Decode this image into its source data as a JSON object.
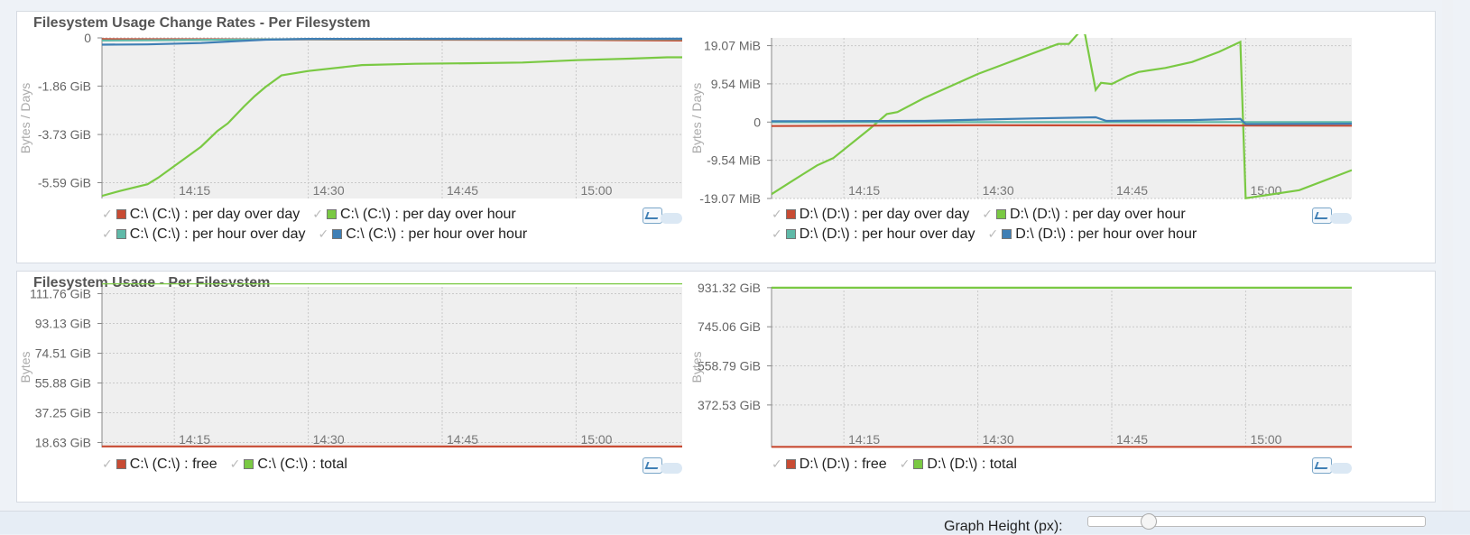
{
  "panels": {
    "rates_title": "Filesystem Usage Change Rates - Per Filesystem",
    "usage_title": "Filesystem Usage - Per Filesystem"
  },
  "footer": {
    "graph_height_label": "Graph Height (px):",
    "graph_height_level": 0.18
  },
  "colors": {
    "red": "#c84b33",
    "green": "#7ac943",
    "teal": "#5fb9a8",
    "blue": "#3f7fb5"
  },
  "chart_data": [
    {
      "id": "c_rates",
      "type": "line",
      "ylabel": "Bytes / Days",
      "ylim": [
        -6.2,
        0
      ],
      "yticks": [
        0,
        -1.86,
        -3.73,
        -5.59
      ],
      "yticklabels": [
        "0",
        "-1.86 GiB",
        "-3.73 GiB",
        "-5.59 GiB"
      ],
      "xlim": [
        14.115,
        15.198
      ],
      "xticks": [
        14.25,
        14.5,
        14.75,
        15.0
      ],
      "xticklabels": [
        "14:15",
        "14:30",
        "14:45",
        "15:00"
      ],
      "grid": true,
      "legend": [
        {
          "label": "C:\\ (C:\\) : per day over day",
          "color": "#c84b33"
        },
        {
          "label": "C:\\ (C:\\) : per day over hour",
          "color": "#7ac943"
        },
        {
          "label": "C:\\ (C:\\) : per hour over day",
          "color": "#5fb9a8"
        },
        {
          "label": "C:\\ (C:\\) : per hour over hour",
          "color": "#3f7fb5"
        }
      ],
      "series": [
        {
          "name": "C:\\ (C:\\) : per day over day",
          "color": "#c84b33",
          "x": [
            14.115,
            14.5,
            15.0,
            15.198
          ],
          "y": [
            -0.05,
            -0.06,
            -0.08,
            -0.1
          ]
        },
        {
          "name": "C:\\ (C:\\) : per day over hour",
          "color": "#7ac943",
          "x": [
            14.115,
            14.15,
            14.2,
            14.22,
            14.3,
            14.33,
            14.35,
            14.38,
            14.4,
            14.42,
            14.45,
            14.5,
            14.6,
            14.7,
            14.8,
            14.9,
            15.0,
            15.1,
            15.17,
            15.198
          ],
          "y": [
            -6.1,
            -5.9,
            -5.65,
            -5.4,
            -4.2,
            -3.6,
            -3.3,
            -2.65,
            -2.25,
            -1.9,
            -1.45,
            -1.28,
            -1.05,
            -1.0,
            -0.98,
            -0.95,
            -0.86,
            -0.8,
            -0.75,
            -0.75
          ]
        },
        {
          "name": "C:\\ (C:\\) : per hour over day",
          "color": "#5fb9a8",
          "x": [
            14.115,
            14.5,
            15.198
          ],
          "y": [
            -0.1,
            -0.05,
            -0.05
          ]
        },
        {
          "name": "C:\\ (C:\\) : per hour over hour",
          "color": "#3f7fb5",
          "x": [
            14.115,
            14.2,
            14.3,
            14.42,
            14.5,
            15.198
          ],
          "y": [
            -0.26,
            -0.25,
            -0.2,
            -0.07,
            -0.04,
            -0.03
          ]
        }
      ]
    },
    {
      "id": "d_rates",
      "type": "line",
      "ylabel": "Bytes / Days",
      "ylim": [
        -19.07,
        21
      ],
      "yticks": [
        19.07,
        9.54,
        0,
        -9.54,
        -19.07
      ],
      "yticklabels": [
        "19.07 MiB",
        "9.54 MiB",
        "0",
        "-9.54 MiB",
        "-19.07 MiB"
      ],
      "xlim": [
        14.115,
        15.198
      ],
      "xticks": [
        14.25,
        14.5,
        14.75,
        15.0
      ],
      "xticklabels": [
        "14:15",
        "14:30",
        "14:45",
        "15:00"
      ],
      "grid": true,
      "legend": [
        {
          "label": "D:\\ (D:\\) : per day over day",
          "color": "#c84b33"
        },
        {
          "label": "D:\\ (D:\\) : per day over hour",
          "color": "#7ac943"
        },
        {
          "label": "D:\\ (D:\\) : per hour over day",
          "color": "#5fb9a8"
        },
        {
          "label": "D:\\ (D:\\) : per hour over hour",
          "color": "#3f7fb5"
        }
      ],
      "series": [
        {
          "name": "D:\\ (D:\\) : per day over day",
          "color": "#c84b33",
          "x": [
            14.115,
            14.5,
            15.198
          ],
          "y": [
            -1.0,
            -0.8,
            -0.9
          ]
        },
        {
          "name": "D:\\ (D:\\) : per day over hour",
          "color": "#7ac943",
          "x": [
            14.115,
            14.15,
            14.2,
            14.23,
            14.3,
            14.33,
            14.35,
            14.4,
            14.5,
            14.55,
            14.58,
            14.62,
            14.65,
            14.67,
            14.69,
            14.7,
            14.72,
            14.73,
            14.75,
            14.78,
            14.8,
            14.85,
            14.9,
            14.95,
            14.99,
            15.0,
            15.1,
            15.198
          ],
          "y": [
            -18.0,
            -15.0,
            -10.8,
            -9.0,
            -1.5,
            2.0,
            2.5,
            6.0,
            12.0,
            14.5,
            16.0,
            18.0,
            19.5,
            19.5,
            22.5,
            22.0,
            8.0,
            9.8,
            9.5,
            11.5,
            12.5,
            13.5,
            15.0,
            17.5,
            20.0,
            -19.0,
            -17.0,
            -12.0
          ]
        },
        {
          "name": "D:\\ (D:\\) : per hour over day",
          "color": "#5fb9a8",
          "x": [
            14.115,
            14.5,
            15.198
          ],
          "y": [
            0.0,
            0.0,
            0.0
          ]
        },
        {
          "name": "D:\\ (D:\\) : per hour over hour",
          "color": "#3f7fb5",
          "x": [
            14.115,
            14.4,
            14.5,
            14.6,
            14.72,
            14.74,
            14.9,
            14.99,
            15.0,
            15.198
          ],
          "y": [
            0.2,
            0.3,
            0.6,
            0.9,
            1.2,
            0.3,
            0.5,
            0.8,
            -0.5,
            -0.4
          ]
        }
      ]
    },
    {
      "id": "c_usage",
      "type": "line",
      "ylabel": "Bytes",
      "ylim": [
        15.5,
        116
      ],
      "yticks": [
        111.76,
        93.13,
        74.51,
        55.88,
        37.25,
        18.63
      ],
      "yticklabels": [
        "111.76 GiB",
        "93.13 GiB",
        "74.51 GiB",
        "55.88 GiB",
        "37.25 GiB",
        "18.63 GiB"
      ],
      "xlim": [
        14.115,
        15.198
      ],
      "xticks": [
        14.25,
        14.5,
        14.75,
        15.0
      ],
      "xticklabels": [
        "14:15",
        "14:30",
        "14:45",
        "15:00"
      ],
      "grid": true,
      "legend": [
        {
          "label": "C:\\ (C:\\) : free",
          "color": "#c84b33"
        },
        {
          "label": "C:\\ (C:\\) : total",
          "color": "#7ac943"
        }
      ],
      "series": [
        {
          "name": "C:\\ (C:\\) : free",
          "color": "#c84b33",
          "x": [
            14.115,
            14.5,
            15.198
          ],
          "y": [
            16.2,
            16.2,
            16.1
          ]
        },
        {
          "name": "C:\\ (C:\\) : total",
          "color": "#7ac943",
          "x": [
            14.115,
            15.198
          ],
          "y": [
            118.2,
            118.2
          ]
        }
      ]
    },
    {
      "id": "d_usage",
      "type": "line",
      "ylabel": "Bytes",
      "ylim": [
        170,
        935
      ],
      "yticks": [
        931.32,
        745.06,
        558.79,
        372.53
      ],
      "yticklabels": [
        "931.32 GiB",
        "745.06 GiB",
        "558.79 GiB",
        "372.53 GiB"
      ],
      "xlim": [
        14.115,
        15.198
      ],
      "xticks": [
        14.25,
        14.5,
        14.75,
        15.0
      ],
      "xticklabels": [
        "14:15",
        "14:30",
        "14:45",
        "15:00"
      ],
      "grid": true,
      "legend": [
        {
          "label": "D:\\ (D:\\) : free",
          "color": "#c84b33"
        },
        {
          "label": "D:\\ (D:\\) : total",
          "color": "#7ac943"
        }
      ],
      "series": [
        {
          "name": "D:\\ (D:\\) : free",
          "color": "#c84b33",
          "x": [
            14.115,
            15.198
          ],
          "y": [
            173,
            173
          ]
        },
        {
          "name": "D:\\ (D:\\) : total",
          "color": "#7ac943",
          "x": [
            14.115,
            15.198
          ],
          "y": [
            931.32,
            931.32
          ]
        }
      ]
    }
  ]
}
